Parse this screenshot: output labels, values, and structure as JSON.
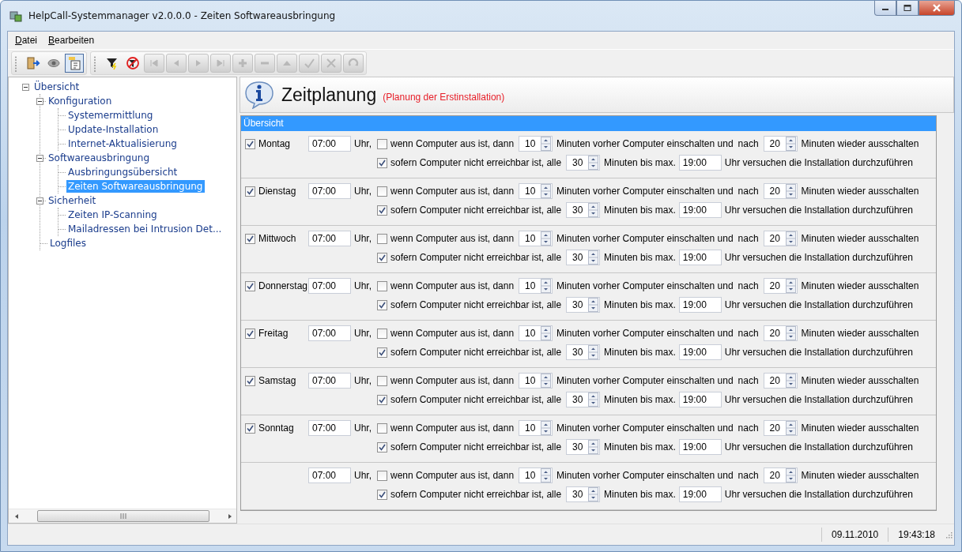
{
  "window": {
    "title": "HelpCall-Systemmanager v2.0.0.0 - Zeiten Softwareausbringung"
  },
  "menu": [
    "Datei",
    "Bearbeiten"
  ],
  "toolbar": [
    {
      "kind": "exit",
      "disabled": false,
      "on": false
    },
    {
      "kind": "eye",
      "disabled": false,
      "on": false
    },
    {
      "kind": "tree",
      "disabled": false,
      "on": true
    },
    {
      "kind": "filter",
      "disabled": false,
      "on": false
    },
    {
      "kind": "filter-off",
      "disabled": false,
      "on": false
    },
    {
      "kind": "first",
      "disabled": true,
      "on": false
    },
    {
      "kind": "prev",
      "disabled": true,
      "on": false
    },
    {
      "kind": "next",
      "disabled": true,
      "on": false
    },
    {
      "kind": "last",
      "disabled": true,
      "on": false
    },
    {
      "kind": "add",
      "disabled": true,
      "on": false
    },
    {
      "kind": "remove",
      "disabled": true,
      "on": false
    },
    {
      "kind": "up",
      "disabled": true,
      "on": false
    },
    {
      "kind": "confirm",
      "disabled": true,
      "on": false
    },
    {
      "kind": "cancel",
      "disabled": true,
      "on": false
    },
    {
      "kind": "refresh",
      "disabled": true,
      "on": false
    }
  ],
  "tree": [
    {
      "label": "Übersicht",
      "expanded": true,
      "selected": false,
      "children": [
        {
          "label": "Konfiguration",
          "expanded": true,
          "selected": false,
          "children": [
            {
              "label": "Systemermittlung",
              "selected": false
            },
            {
              "label": "Update-Installation",
              "selected": false
            },
            {
              "label": "Internet-Aktualisierung",
              "selected": false
            }
          ]
        },
        {
          "label": "Softwareausbringung",
          "expanded": true,
          "selected": false,
          "children": [
            {
              "label": "Ausbringungsübersicht",
              "selected": false
            },
            {
              "label": "Zeiten Softwareausbringung",
              "selected": true
            }
          ]
        },
        {
          "label": "Sicherheit",
          "expanded": true,
          "selected": false,
          "children": [
            {
              "label": "Zeiten IP-Scanning",
              "selected": false
            },
            {
              "label": "Mailadressen bei Intrusion Det...",
              "selected": false
            }
          ]
        },
        {
          "label": "Logfiles",
          "selected": false
        }
      ]
    }
  ],
  "header": {
    "title": "Zeitplanung",
    "subtitle": "(Planung der Erstinstallation)"
  },
  "group": {
    "title": "Übersicht"
  },
  "rows": [
    {
      "day": {
        "label": "Montag",
        "checked": true
      },
      "time": "07:00",
      "uhr": "Uhr,",
      "wake_checked": false,
      "wake_label": "wenn Computer aus ist, dann",
      "wake_minutes": "10",
      "before_label": "Minuten vorher Computer einschalten und",
      "after_label": "nach",
      "off_minutes": "20",
      "off_label": "Minuten wieder ausschalten",
      "retry_checked": true,
      "retry_label": "sofern Computer nicht erreichbar ist, alle",
      "retry_minutes": "30",
      "retry_unit": "Minuten bis max.",
      "max_time": "19:00",
      "tail": "Uhr versuchen die Installation durchzuführen"
    },
    {
      "day": {
        "label": "Dienstag",
        "checked": true
      },
      "time": "07:00",
      "uhr": "Uhr,",
      "wake_checked": false,
      "wake_label": "wenn Computer aus ist, dann",
      "wake_minutes": "10",
      "before_label": "Minuten vorher Computer einschalten und",
      "after_label": "nach",
      "off_minutes": "20",
      "off_label": "Minuten wieder ausschalten",
      "retry_checked": true,
      "retry_label": "sofern Computer nicht erreichbar ist, alle",
      "retry_minutes": "30",
      "retry_unit": "Minuten bis max.",
      "max_time": "19:00",
      "tail": "Uhr versuchen die Installation durchzuführen"
    },
    {
      "day": {
        "label": "Mittwoch",
        "checked": true
      },
      "time": "07:00",
      "uhr": "Uhr,",
      "wake_checked": false,
      "wake_label": "wenn Computer aus ist, dann",
      "wake_minutes": "10",
      "before_label": "Minuten vorher Computer einschalten und",
      "after_label": "nach",
      "off_minutes": "20",
      "off_label": "Minuten wieder ausschalten",
      "retry_checked": true,
      "retry_label": "sofern Computer nicht erreichbar ist, alle",
      "retry_minutes": "30",
      "retry_unit": "Minuten bis max.",
      "max_time": "19:00",
      "tail": "Uhr versuchen die Installation durchzuführen"
    },
    {
      "day": {
        "label": "Donnerstag",
        "checked": true
      },
      "time": "07:00",
      "uhr": "Uhr,",
      "wake_checked": false,
      "wake_label": "wenn Computer aus ist, dann",
      "wake_minutes": "10",
      "before_label": "Minuten vorher Computer einschalten und",
      "after_label": "nach",
      "off_minutes": "20",
      "off_label": "Minuten wieder ausschalten",
      "retry_checked": true,
      "retry_label": "sofern Computer nicht erreichbar ist, alle",
      "retry_minutes": "30",
      "retry_unit": "Minuten bis max.",
      "max_time": "19:00",
      "tail": "Uhr versuchen die Installation durchzuführen"
    },
    {
      "day": {
        "label": "Freitag",
        "checked": true
      },
      "time": "07:00",
      "uhr": "Uhr,",
      "wake_checked": false,
      "wake_label": "wenn Computer aus ist, dann",
      "wake_minutes": "10",
      "before_label": "Minuten vorher Computer einschalten und",
      "after_label": "nach",
      "off_minutes": "20",
      "off_label": "Minuten wieder ausschalten",
      "retry_checked": true,
      "retry_label": "sofern Computer nicht erreichbar ist, alle",
      "retry_minutes": "30",
      "retry_unit": "Minuten bis max.",
      "max_time": "19:00",
      "tail": "Uhr versuchen die Installation durchzuführen"
    },
    {
      "day": {
        "label": "Samstag",
        "checked": true
      },
      "time": "07:00",
      "uhr": "Uhr,",
      "wake_checked": false,
      "wake_label": "wenn Computer aus ist, dann",
      "wake_minutes": "10",
      "before_label": "Minuten vorher Computer einschalten und",
      "after_label": "nach",
      "off_minutes": "20",
      "off_label": "Minuten wieder ausschalten",
      "retry_checked": true,
      "retry_label": "sofern Computer nicht erreichbar ist, alle",
      "retry_minutes": "30",
      "retry_unit": "Minuten bis max.",
      "max_time": "19:00",
      "tail": "Uhr versuchen die Installation durchzuführen"
    },
    {
      "day": {
        "label": "Sonntag",
        "checked": true
      },
      "time": "07:00",
      "uhr": "Uhr,",
      "wake_checked": false,
      "wake_label": "wenn Computer aus ist, dann",
      "wake_minutes": "10",
      "before_label": "Minuten vorher Computer einschalten und",
      "after_label": "nach",
      "off_minutes": "20",
      "off_label": "Minuten wieder ausschalten",
      "retry_checked": true,
      "retry_label": "sofern Computer nicht erreichbar ist, alle",
      "retry_minutes": "30",
      "retry_unit": "Minuten bis max.",
      "max_time": "19:00",
      "tail": "Uhr versuchen die Installation durchzuführen"
    },
    {
      "time": "07:00",
      "uhr": "Uhr,",
      "wake_checked": false,
      "wake_label": "wenn Computer aus ist, dann",
      "wake_minutes": "10",
      "before_label": "Minuten vorher Computer einschalten und",
      "after_label": "nach",
      "off_minutes": "20",
      "off_label": "Minuten wieder ausschalten",
      "retry_checked": true,
      "retry_label": "sofern Computer nicht erreichbar ist, alle",
      "retry_minutes": "30",
      "retry_unit": "Minuten bis max.",
      "max_time": "19:00",
      "tail": "Uhr versuchen die Installation durchzuführen"
    }
  ],
  "status_bar": {
    "date": "09.11.2010",
    "time": "19:43:18"
  }
}
